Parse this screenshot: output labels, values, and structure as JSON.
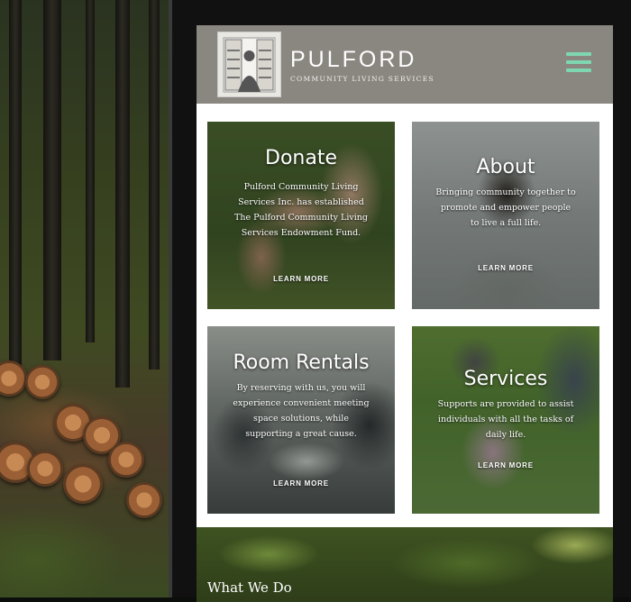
{
  "header": {
    "brand_name": "PULFORD",
    "brand_sub": "COMMUNITY LIVING SERVICES",
    "menu_icon": "hamburger-menu-icon",
    "accent": "#7fd6b2",
    "bar_color": "#8a8680"
  },
  "tiles": [
    {
      "title": "Donate",
      "description": "Pulford Community Living Services Inc. has established The Pulford Community Living Services Endowment Fund.",
      "link": "LEARN MORE"
    },
    {
      "title": "About",
      "description": "Bringing community together to promote and empower people to live a full life.",
      "link": "LEARN MORE"
    },
    {
      "title": "Room Rentals",
      "description": "By reserving with us, you will experience convenient meeting space solutions, while supporting a great cause.",
      "link": "LEARN MORE"
    },
    {
      "title": "Services",
      "description": "Supports are provided to assist individuals with all the tasks of daily life.",
      "link": "LEARN MORE"
    }
  ],
  "footer": {
    "section_title": "What We Do"
  }
}
